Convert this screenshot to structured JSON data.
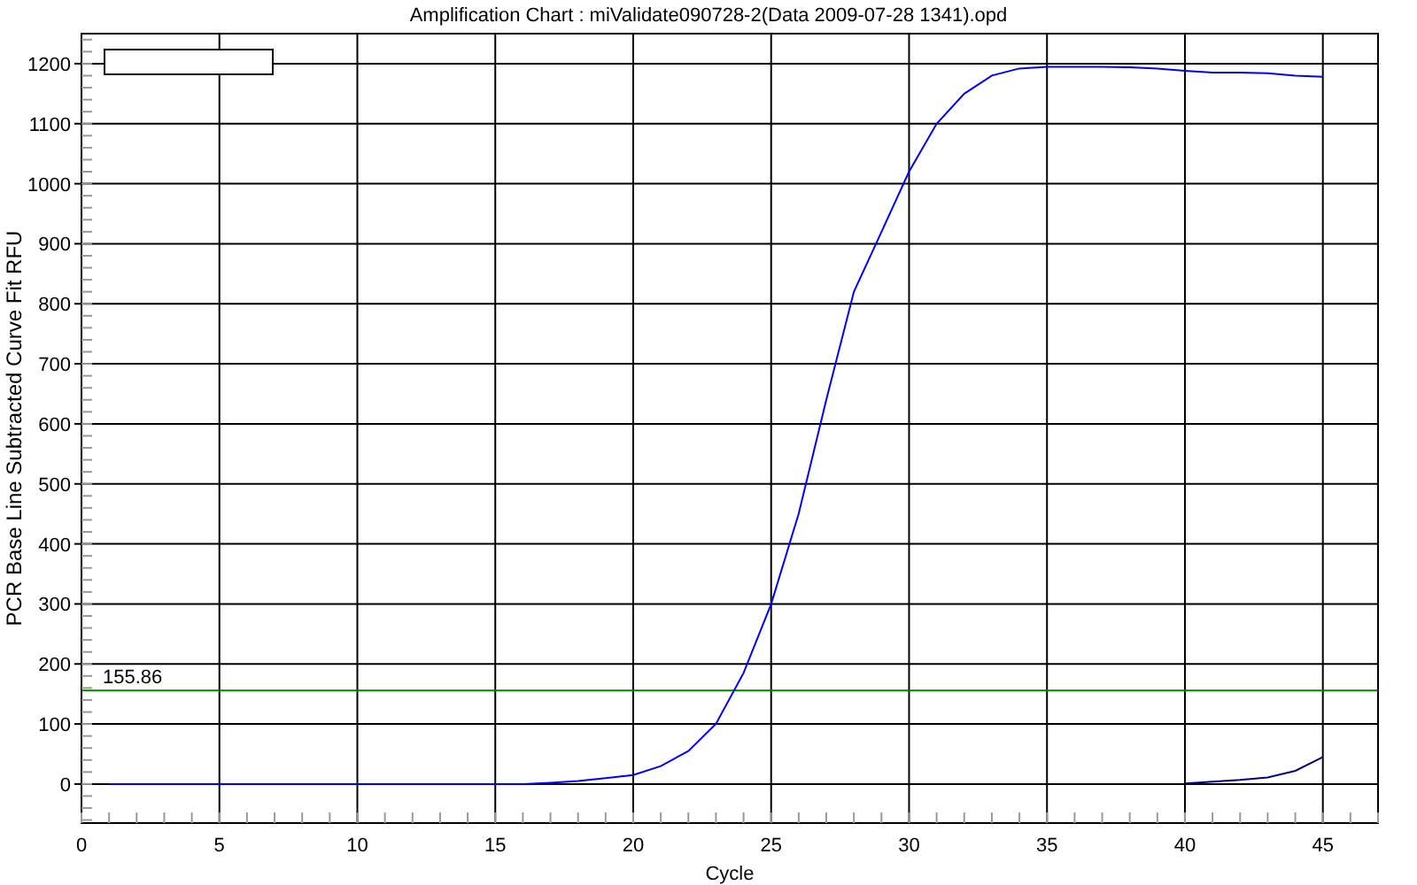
{
  "chart": {
    "chart_data": {
      "type": "line",
      "title": "Amplification Chart : miValidate090728-2(Data 2009-07-28 1341).opd",
      "xlabel": "Cycle",
      "ylabel": "PCR Base Line Subtracted Curve Fit RFU",
      "x": [
        1,
        2,
        3,
        4,
        5,
        6,
        7,
        8,
        9,
        10,
        11,
        12,
        13,
        14,
        15,
        16,
        17,
        18,
        19,
        20,
        21,
        22,
        23,
        24,
        25,
        26,
        27,
        28,
        29,
        30,
        31,
        32,
        33,
        34,
        35,
        36,
        37,
        38,
        39,
        40,
        41,
        42,
        43,
        44,
        45
      ],
      "series": [
        {
          "color": "#0000ff",
          "values": [
            0,
            0,
            0,
            0,
            0,
            0,
            0,
            0,
            0,
            0,
            0,
            0,
            0,
            0,
            0,
            0,
            2,
            5,
            10,
            15,
            30,
            55,
            100,
            185,
            300,
            450,
            640,
            820,
            920,
            1020,
            1100,
            1150,
            1180,
            1192,
            1195,
            1195,
            1195,
            1194,
            1192,
            1188,
            1185,
            1185,
            1184,
            1180,
            1178
          ]
        },
        {
          "color": "#000080",
          "values": [
            null,
            null,
            null,
            null,
            null,
            null,
            null,
            null,
            null,
            null,
            null,
            null,
            null,
            null,
            null,
            null,
            null,
            null,
            null,
            null,
            null,
            null,
            null,
            null,
            null,
            null,
            null,
            null,
            null,
            null,
            null,
            null,
            null,
            null,
            null,
            null,
            null,
            null,
            null,
            1,
            4,
            7,
            11,
            22,
            45
          ]
        }
      ],
      "xlim": [
        0,
        47
      ],
      "ylim": [
        -65,
        1250
      ],
      "grid": true,
      "xticks": [
        0,
        5,
        10,
        15,
        20,
        25,
        30,
        35,
        40,
        45
      ],
      "yticks": [
        0,
        100,
        200,
        300,
        400,
        500,
        600,
        700,
        800,
        900,
        1000,
        1100,
        1200
      ],
      "ref_lines": [
        {
          "axis": "y",
          "value": 155.86,
          "label": "155.86",
          "color": "#008000"
        }
      ]
    }
  }
}
